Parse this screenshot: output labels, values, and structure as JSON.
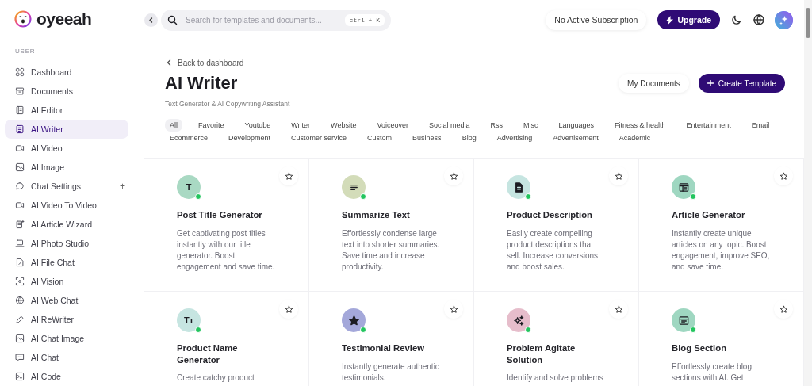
{
  "brand": {
    "name": "oyeeah"
  },
  "sidebar": {
    "section": "USER",
    "items": [
      {
        "label": "Dashboard",
        "selected": false
      },
      {
        "label": "Documents",
        "selected": false
      },
      {
        "label": "AI Editor",
        "selected": false
      },
      {
        "label": "AI Writer",
        "selected": true
      },
      {
        "label": "AI Video",
        "selected": false
      },
      {
        "label": "AI Image",
        "selected": false
      },
      {
        "label": "Chat Settings",
        "selected": false,
        "expand": "+"
      },
      {
        "label": "AI Video To Video",
        "selected": false
      },
      {
        "label": "AI Article Wizard",
        "selected": false
      },
      {
        "label": "AI Photo Studio",
        "selected": false
      },
      {
        "label": "AI File Chat",
        "selected": false
      },
      {
        "label": "AI Vision",
        "selected": false
      },
      {
        "label": "AI Web Chat",
        "selected": false
      },
      {
        "label": "AI ReWriter",
        "selected": false
      },
      {
        "label": "AI Chat Image",
        "selected": false
      },
      {
        "label": "AI Chat",
        "selected": false
      },
      {
        "label": "AI Code",
        "selected": false
      }
    ]
  },
  "topbar": {
    "search": {
      "placeholder": "Search for templates and documents...",
      "shortcut": "ctrl + K"
    },
    "subscription": "No Active Subscription",
    "upgrade": "Upgrade"
  },
  "header": {
    "back": "Back to dashboard",
    "title": "AI Writer",
    "subtitle": "Text Generator & AI Copywriting Assistant",
    "buttons": [
      "My Documents",
      "Create Template"
    ]
  },
  "filters": [
    {
      "label": "All",
      "selected": true
    },
    {
      "label": "Favorite",
      "selected": false
    },
    {
      "label": "Youtube",
      "selected": false
    },
    {
      "label": "Writer",
      "selected": false
    },
    {
      "label": "Website",
      "selected": false
    },
    {
      "label": "Voiceover",
      "selected": false
    },
    {
      "label": "Social media",
      "selected": false
    },
    {
      "label": "Rss",
      "selected": false
    },
    {
      "label": "Misc",
      "selected": false
    },
    {
      "label": "Languages",
      "selected": false
    },
    {
      "label": "Fitness & health",
      "selected": false
    },
    {
      "label": "Entertainment",
      "selected": false
    },
    {
      "label": "Email",
      "selected": false
    },
    {
      "label": "Ecommerce",
      "selected": false
    },
    {
      "label": "Development",
      "selected": false
    },
    {
      "label": "Customer service",
      "selected": false
    },
    {
      "label": "Custom",
      "selected": false
    },
    {
      "label": "Business",
      "selected": false
    },
    {
      "label": "Blog",
      "selected": false
    },
    {
      "label": "Advertising",
      "selected": false
    },
    {
      "label": "Advertisement",
      "selected": false
    },
    {
      "label": "Academic",
      "selected": false
    }
  ],
  "cards": [
    {
      "title": "Post Title Generator",
      "description": "Get captivating post titles instantly with our title generator. Boost engagement and save time.",
      "color": "#a9d9c3",
      "icon": {
        "kind": "letter",
        "text": "T"
      }
    },
    {
      "title": "Summarize Text",
      "description": "Effortlessly condense large text into shorter summaries. Save time and increase productivity.",
      "color": "#d3dcb9",
      "icon": {
        "kind": "lines"
      }
    },
    {
      "title": "Product Description",
      "description": "Easily create compelling product descriptions that sell. Increase conversions and boost sales.",
      "color": "#c6e5e1",
      "icon": {
        "kind": "document"
      }
    },
    {
      "title": "Article Generator",
      "description": "Instantly create unique articles on any topic. Boost engagement, improve SEO, and save time.",
      "color": "#9fd7c1",
      "icon": {
        "kind": "layout"
      }
    },
    {
      "title": "Product Name Generator",
      "description": "Create catchy product",
      "color": "#c6e5e1",
      "icon": {
        "kind": "letter",
        "text": "Tт"
      }
    },
    {
      "title": "Testimonial Review",
      "description": "Instantly generate authentic testimonials.",
      "color": "#a4a8da",
      "icon": {
        "kind": "star"
      }
    },
    {
      "title": "Problem Agitate Solution",
      "description": "Identify and solve problems",
      "color": "#e6bdcb",
      "icon": {
        "kind": "sparkle"
      }
    },
    {
      "title": "Blog Section",
      "description": "Effortlessly create blog sections with AI. Get",
      "color": "#9fd7c1",
      "icon": {
        "kind": "window"
      }
    }
  ]
}
